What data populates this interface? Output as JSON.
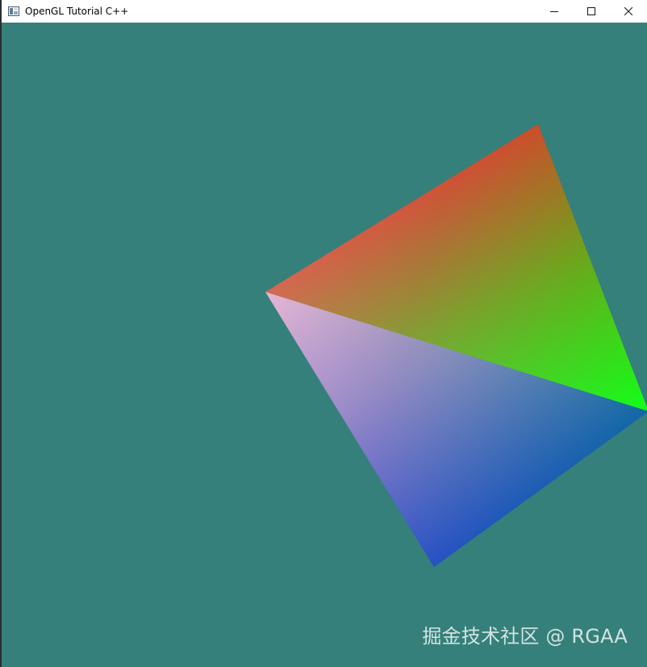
{
  "window": {
    "title": "OpenGL Tutorial C++",
    "app_icon": "opengl-window-icon",
    "controls": [
      {
        "name": "minimize",
        "icon": "minimize-icon"
      },
      {
        "name": "maximize",
        "icon": "maximize-icon"
      },
      {
        "name": "close",
        "icon": "close-icon"
      }
    ]
  },
  "viewport": {
    "clear_color": "#35807a",
    "quad": {
      "vertex_colors": {
        "top_right": "#ff0000",
        "bottom_right": "#00ff00",
        "bottom_left": "#0000ff",
        "top_left": "#e5b4d4"
      }
    }
  },
  "watermark": {
    "text": "掘金技术社区 @ RGAA"
  }
}
